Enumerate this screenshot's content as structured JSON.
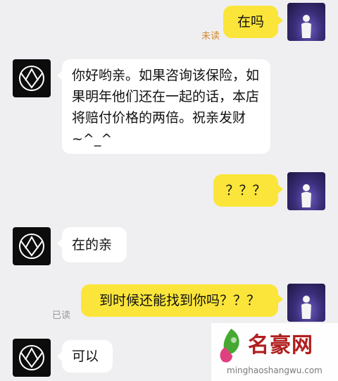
{
  "messages": [
    {
      "side": "self",
      "text": "在吗",
      "status": "未读"
    },
    {
      "side": "other",
      "text": "你好哟亲。如果咨询该保险，如果明年他们还在一起的话，本店将赔付价格的两倍。祝亲发财~^_^"
    },
    {
      "side": "self",
      "text": "？？？"
    },
    {
      "side": "other",
      "text": "在的亲"
    },
    {
      "side": "self",
      "text": "到时候还能找到你吗？？？",
      "status": "已读"
    },
    {
      "side": "other",
      "text": "可以"
    }
  ],
  "watermark": {
    "name": "名豪网",
    "url": "minghaoshangwu.com"
  },
  "colors": {
    "self_bubble": "#fbe53a",
    "other_bubble": "#ffffff",
    "background": "#efeff2",
    "unread": "#d48a2a",
    "read": "#9a9a9a"
  }
}
